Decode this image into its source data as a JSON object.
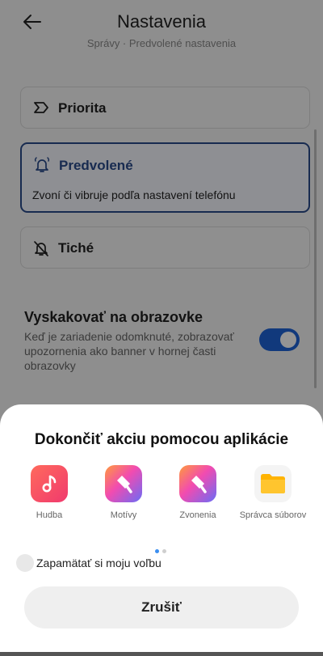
{
  "settings": {
    "title": "Nastavenia",
    "breadcrumb": "Správy · Predvolené nastavenia",
    "options": [
      {
        "label": "Priorita",
        "icon": "priority-icon"
      },
      {
        "label": "Predvolené",
        "icon": "bell-ring-icon",
        "description": "Zvoní či vibruje podľa nastavení telefónu",
        "selected": true
      },
      {
        "label": "Tiché",
        "icon": "bell-off-icon"
      }
    ],
    "popup": {
      "title": "Vyskakovať na obrazovke",
      "description": "Keď je zariadenie odomknuté, zobrazovať upozornenia ako banner v hornej časti obrazovky",
      "enabled": true
    }
  },
  "sheet": {
    "title": "Dokončiť akciu pomocou aplikácie",
    "apps": [
      {
        "label": "Hudba",
        "icon": "music-note-icon"
      },
      {
        "label": "Motívy",
        "icon": "paint-brush-icon"
      },
      {
        "label": "Zvonenia",
        "icon": "paint-brush-icon"
      },
      {
        "label": "Správca súborov",
        "icon": "folder-icon"
      }
    ],
    "remember_label": "Zapamätať si moju voľbu",
    "cancel_label": "Zrušiť",
    "page_count": 2,
    "current_page": 1
  },
  "colors": {
    "accent": "#1e63d6",
    "selected_border": "#2a4a8a",
    "music": "#f44a5a",
    "themes": "#9b5cf6",
    "folder": "#ffb300"
  }
}
